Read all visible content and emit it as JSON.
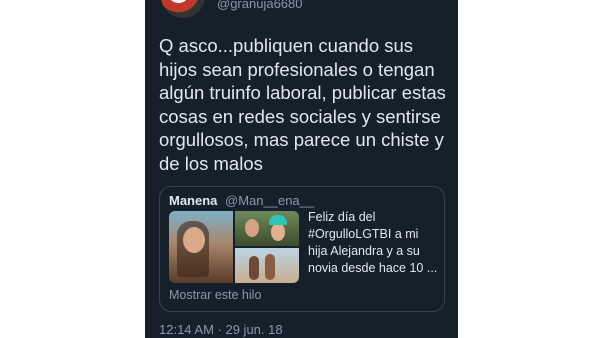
{
  "tweet": {
    "handle": "@granuja6680",
    "text": "Q asco...publiquen cuando sus hijos sean profesionales o tengan algún truinfo laboral, publicar estas cosas en redes sociales y sentirse orgullosos, mas parece un chiste y de los malos",
    "timestamp": "12:14 AM · 29 jun. 18"
  },
  "quoted": {
    "name": "Manena",
    "handle": "@Man__ena__",
    "text": "Feliz día del #OrgulloLGTBI a mi hija Alejandra y a su novia desde hace 10 ...",
    "thread_link": "Mostrar este hilo"
  },
  "colors": {
    "background": "#15202b",
    "text": "#e1e8ed",
    "secondary": "#8899a6",
    "border": "#38444d"
  }
}
